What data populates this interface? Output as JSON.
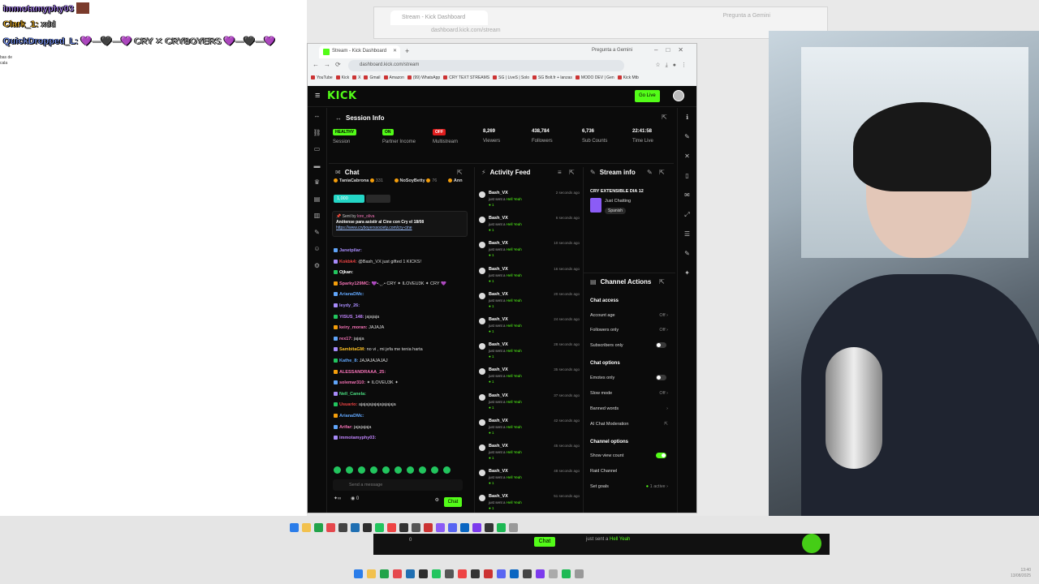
{
  "overlay_chat": [
    {
      "user": "immotamyphy03",
      "color": "#b389ff",
      "text": ""
    },
    {
      "user": "Clark_1",
      "color": "#f0b429",
      "text": "xdd"
    },
    {
      "user": "QuickDropped_L",
      "color": "#7d9bff",
      "text": "💜—🖤—💜 CRY ✕ CRYBOYERS 💜—🖤—💜"
    }
  ],
  "bg_browser": {
    "tab": "Stream - Kick Dashboard",
    "gemini": "Pregunta a Gemini",
    "url": "dashboard.kick.com/stream"
  },
  "browser": {
    "tab_title": "Stream - Kick Dashboard",
    "gemini": "Pregunta a Gemini",
    "url": "dashboard.kick.com/stream",
    "bookmarks": [
      "YouTube",
      "Kick",
      "X",
      "Gmail",
      "Amazon",
      "(99) WhatsApp",
      "CRY TEXT STREAMS",
      "SG | LiveS | Solo",
      "SG Bolt.fr + lanzas",
      "MODO DEV | Gen",
      "Kick Mtb"
    ]
  },
  "kick": {
    "logo": "KICK",
    "go_live": "Go Live"
  },
  "session": {
    "title": "Session Info",
    "status": [
      {
        "pill": "HEALTHY",
        "pill_color": "green",
        "label": "Session"
      },
      {
        "pill": "ON",
        "pill_color": "green",
        "label": "Partner Income"
      },
      {
        "pill": "OFF",
        "pill_color": "red",
        "label": "Multistream"
      }
    ],
    "stats": [
      {
        "value": "8,269",
        "label": "Viewers"
      },
      {
        "value": "438,784",
        "label": "Followers"
      },
      {
        "value": "6,736",
        "label": "Sub Counts"
      },
      {
        "value": "22:41:58",
        "label": "Time Live"
      }
    ]
  },
  "chat": {
    "title": "Chat",
    "pinned_users": [
      {
        "name": "TaniaCabrona",
        "count": "331"
      },
      {
        "name": "NoSoyBetty",
        "count": "76"
      },
      {
        "name": "Ann",
        "count": ""
      }
    ],
    "goal": "1,000",
    "pinned_message": {
      "sent_by_label": "Sent by",
      "sent_by": "lore_oliva",
      "text": "Anótense para asistir al Cine con Cry el 18/08",
      "link": "https://www.cryboyerssociety.com/cry-cine"
    },
    "messages": [
      {
        "user": "Janetpilar:",
        "color": "#a78bfa",
        "text": ""
      },
      {
        "user": "Kokbk4:",
        "color": "#ef4444",
        "text": "@Bash_VX just gifted 1 KICKS!"
      },
      {
        "user": "Ojkan:",
        "color": "#fff",
        "text": ""
      },
      {
        "user": "Sparky129MC:",
        "color": "#f472b6",
        "text": "💜•.¸¸.• CRY ✦ ILOVEU3K ✦ CRY 💜"
      },
      {
        "user": "ArianaDMc:",
        "color": "#60a5fa",
        "text": ""
      },
      {
        "user": "leydy_26:",
        "color": "#a78bfa",
        "text": ""
      },
      {
        "user": "YISUS_148:",
        "color": "#c084fc",
        "text": "jajajaja"
      },
      {
        "user": "keiry_moran:",
        "color": "#f472b6",
        "text": "JAJAJA"
      },
      {
        "user": "rex17:",
        "color": "#f472b6",
        "text": "jajaja"
      },
      {
        "user": "SambitaGM:",
        "color": "#fbbf24",
        "text": "no vi , mi jefa me tenia harta"
      },
      {
        "user": "Kathe_8:",
        "color": "#60a5fa",
        "text": "JAJAJAJAJAJ"
      },
      {
        "user": "ALESSANDRAAA_25:",
        "color": "#f472b6",
        "text": ""
      },
      {
        "user": "solemar310:",
        "color": "#f472b6",
        "text": "✦ ILOVEU3K ✦"
      },
      {
        "user": "Nell_Canela:",
        "color": "#4ade80",
        "text": ""
      },
      {
        "user": "Usuario:",
        "color": "#ef4444",
        "text": "ajajajajajajajajajaja"
      },
      {
        "user": "ArianaDMc:",
        "color": "#60a5fa",
        "text": ""
      },
      {
        "user": "Arifar:",
        "color": "#f472b6",
        "text": "jajajajaja"
      },
      {
        "user": "immotamyphy03:",
        "color": "#c084fc",
        "text": ""
      }
    ],
    "send_placeholder": "Send a message",
    "kicks_count": "0",
    "chat_button": "Chat"
  },
  "activity": {
    "title": "Activity Feed",
    "items": [
      {
        "name": "Bash_VX",
        "prefix": "just sent a",
        "item": "Hell Yeah",
        "count": "1",
        "time": "2 seconds ago"
      },
      {
        "name": "Bash_VX",
        "prefix": "just sent a",
        "item": "Hell Yeah",
        "count": "1",
        "time": "6 seconds ago"
      },
      {
        "name": "Bash_VX",
        "prefix": "just sent a",
        "item": "Hell Yeah",
        "count": "1",
        "time": "10 seconds ago"
      },
      {
        "name": "Bash_VX",
        "prefix": "just sent a",
        "item": "Hell Yeah",
        "count": "1",
        "time": "16 seconds ago"
      },
      {
        "name": "Bash_VX",
        "prefix": "just sent a",
        "item": "Hell Yeah",
        "count": "1",
        "time": "20 seconds ago"
      },
      {
        "name": "Bash_VX",
        "prefix": "just sent a",
        "item": "Hell Yeah",
        "count": "1",
        "time": "24 seconds ago"
      },
      {
        "name": "Bash_VX",
        "prefix": "just sent a",
        "item": "Hell Yeah",
        "count": "1",
        "time": "28 seconds ago"
      },
      {
        "name": "Bash_VX",
        "prefix": "just sent a",
        "item": "Hell Yeah",
        "count": "1",
        "time": "35 seconds ago"
      },
      {
        "name": "Bash_VX",
        "prefix": "just sent a",
        "item": "Hell Yeah",
        "count": "1",
        "time": "37 seconds ago"
      },
      {
        "name": "Bash_VX",
        "prefix": "just sent a",
        "item": "Hell Yeah",
        "count": "1",
        "time": "42 seconds ago"
      },
      {
        "name": "Bash_VX",
        "prefix": "just sent a",
        "item": "Hell Yeah",
        "count": "1",
        "time": "45 seconds ago"
      },
      {
        "name": "Bash_VX",
        "prefix": "just sent a",
        "item": "Hell Yeah",
        "count": "1",
        "time": "48 seconds ago"
      },
      {
        "name": "Bash_VX",
        "prefix": "just sent a",
        "item": "Hell Yeah",
        "count": "1",
        "time": "51 seconds ago"
      }
    ]
  },
  "stream_info": {
    "title": "Stream info",
    "stream_title": "CRY EXTENSIBLE DIA 12",
    "category": "Just Chatting",
    "language": "Spanish"
  },
  "channel_actions": {
    "title": "Channel Actions",
    "chat_access": "Chat access",
    "account_age": {
      "label": "Account age",
      "value": "Off"
    },
    "followers_only": {
      "label": "Followers only",
      "value": "Off"
    },
    "subscribers_only": {
      "label": "Subscribers only",
      "on": false
    },
    "chat_options": "Chat options",
    "emotes_only": {
      "label": "Emotes only",
      "on": false
    },
    "slow_mode": {
      "label": "Slow mode",
      "value": "Off"
    },
    "banned_words": "Banned words",
    "ai_moderation": "AI Chat Moderation",
    "channel_options": "Channel options",
    "show_view_count": {
      "label": "Show view count",
      "on": true
    },
    "raid_channel": "Raid Channel",
    "set_goals": {
      "label": "Set goals",
      "value": "1 active"
    }
  },
  "bg_kick": {
    "chat": "Chat",
    "msg_prefix": "just sent a",
    "msg_item": "Hell Yeah",
    "count": "0"
  },
  "clock": {
    "time": "13:40",
    "date": "13/08/2025"
  }
}
